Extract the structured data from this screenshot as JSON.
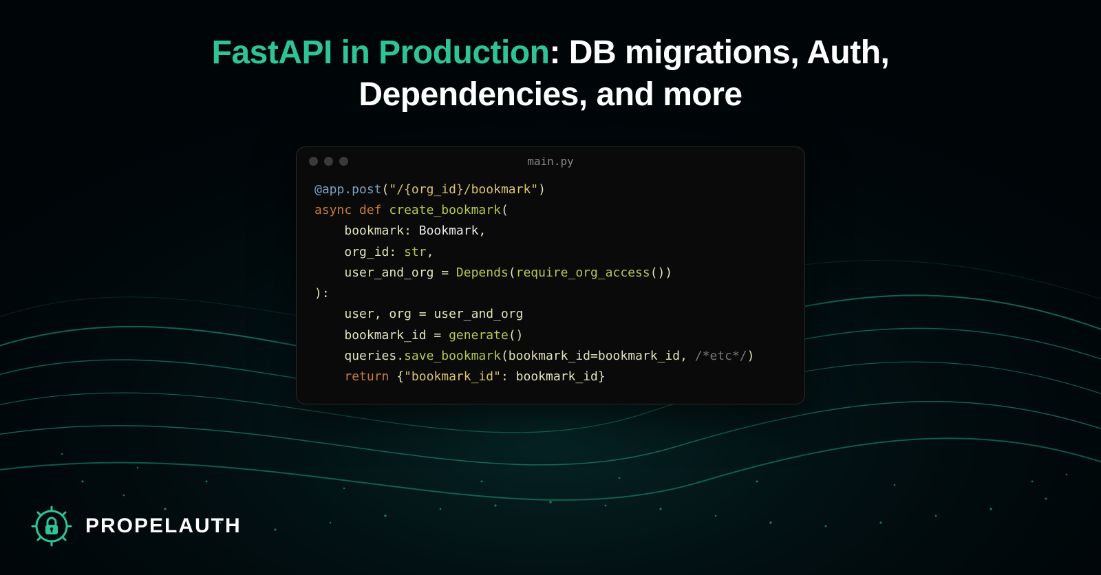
{
  "title": {
    "accent": "FastAPI in Production",
    "rest_line1": ": DB migrations, Auth,",
    "line2": "Dependencies, and more"
  },
  "code": {
    "filename": "main.py",
    "lines": {
      "l1_dec": "@app.post",
      "l1_paren_open": "(",
      "l1_str": "\"/{org_id}/bookmark\"",
      "l1_paren_close": ")",
      "l2_async": "async",
      "l2_def": "def",
      "l2_fn": "create_bookmark",
      "l2_paren": "(",
      "l3_indent": "    ",
      "l3_param": "bookmark",
      "l3_colon": ": ",
      "l3_type": "Bookmark",
      "l3_comma": ",",
      "l4_param": "org_id",
      "l4_type": "str",
      "l5_param": "user_and_org",
      "l5_eq": " = ",
      "l5_dep": "Depends",
      "l5_inner": "require_org_access",
      "l5_tail": "())",
      "l6_close": "):",
      "l7_lhs1": "user",
      "l7_comma": ", ",
      "l7_lhs2": "org",
      "l7_eq": " = ",
      "l7_rhs": "user_and_org",
      "l8_lhs": "bookmark_id",
      "l8_eq": " = ",
      "l8_call": "generate",
      "l8_tail": "()",
      "l9_obj": "queries",
      "l9_dot": ".",
      "l9_call": "save_bookmark",
      "l9_arg1k": "bookmark_id",
      "l9_arg1v": "bookmark_id",
      "l9_cmt": "/*etc*/",
      "l10_ret": "return",
      "l10_key": "\"bookmark_id\"",
      "l10_val": "bookmark_id"
    }
  },
  "brand": {
    "name": "PROPELAUTH"
  }
}
